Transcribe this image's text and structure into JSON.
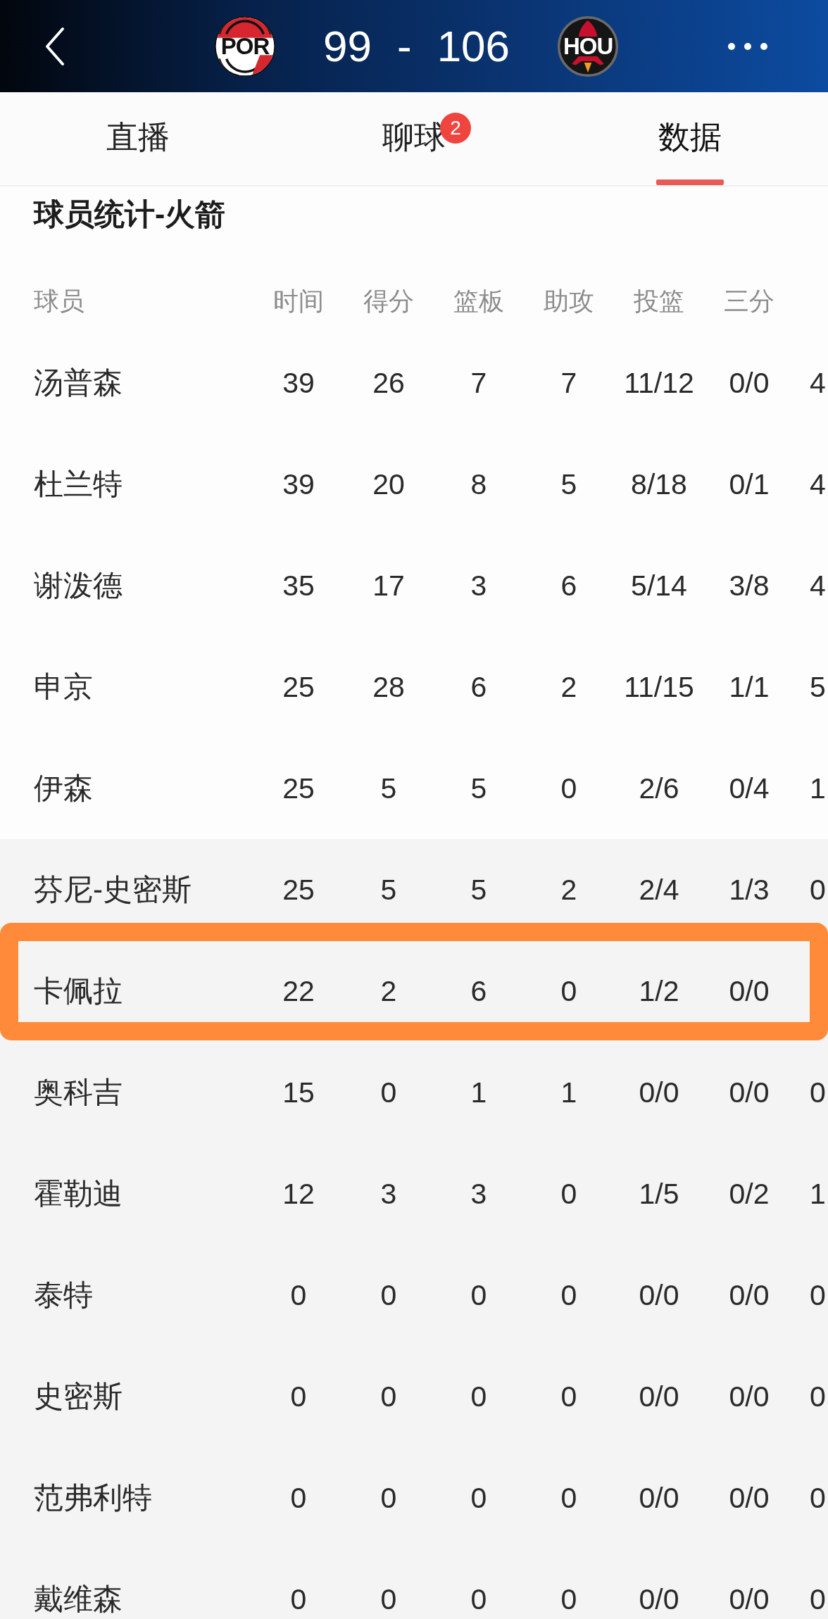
{
  "top_bar": {
    "home_team": {
      "abbr": "POR"
    },
    "score": {
      "home": "99",
      "separator": "-",
      "away": "106"
    },
    "away_team": {
      "abbr": "HOU"
    }
  },
  "tabs": [
    {
      "label": "直播",
      "selected": false
    },
    {
      "label": "聊球",
      "selected": false,
      "badge": "2"
    },
    {
      "label": "数据",
      "selected": true
    }
  ],
  "section_title": "球员统计-火箭",
  "table": {
    "columns": [
      "球员",
      "时间",
      "得分",
      "篮板",
      "助攻",
      "投篮",
      "三分"
    ],
    "rows": [
      {
        "kind": "starter",
        "cells": [
          "汤普森",
          "39",
          "26",
          "7",
          "7",
          "11/12",
          "0/0",
          "4"
        ],
        "highlighted": false
      },
      {
        "kind": "starter",
        "cells": [
          "杜兰特",
          "39",
          "20",
          "8",
          "5",
          "8/18",
          "0/1",
          "4"
        ],
        "highlighted": false
      },
      {
        "kind": "starter",
        "cells": [
          "谢泼德",
          "35",
          "17",
          "3",
          "6",
          "5/14",
          "3/8",
          "4"
        ],
        "highlighted": false
      },
      {
        "kind": "starter",
        "cells": [
          "申京",
          "25",
          "28",
          "6",
          "2",
          "11/15",
          "1/1",
          "5"
        ],
        "highlighted": false
      },
      {
        "kind": "starter",
        "cells": [
          "伊森",
          "25",
          "5",
          "5",
          "0",
          "2/6",
          "0/4",
          "1"
        ],
        "highlighted": false
      },
      {
        "kind": "bench",
        "cells": [
          "芬尼-史密斯",
          "25",
          "5",
          "5",
          "2",
          "2/4",
          "1/3",
          "0"
        ],
        "highlighted": false
      },
      {
        "kind": "bench",
        "cells": [
          "卡佩拉",
          "22",
          "2",
          "6",
          "0",
          "1/2",
          "0/0"
        ],
        "highlighted": true
      },
      {
        "kind": "bench",
        "cells": [
          "奥科吉",
          "15",
          "0",
          "1",
          "1",
          "0/0",
          "0/0",
          "0"
        ],
        "highlighted": false
      },
      {
        "kind": "bench",
        "cells": [
          "霍勒迪",
          "12",
          "3",
          "3",
          "0",
          "1/5",
          "0/2",
          "1"
        ],
        "highlighted": false
      },
      {
        "kind": "bench",
        "cells": [
          "泰特",
          "0",
          "0",
          "0",
          "0",
          "0/0",
          "0/0",
          "0"
        ],
        "highlighted": false
      },
      {
        "kind": "bench",
        "cells": [
          "史密斯",
          "0",
          "0",
          "0",
          "0",
          "0/0",
          "0/0",
          "0"
        ],
        "highlighted": false
      },
      {
        "kind": "bench",
        "cells": [
          "范弗利特",
          "0",
          "0",
          "0",
          "0",
          "0/0",
          "0/0",
          "0"
        ],
        "highlighted": false
      },
      {
        "kind": "bench",
        "cells": [
          "戴维森",
          "0",
          "0",
          "0",
          "0",
          "0/0",
          "0/0",
          "0"
        ],
        "highlighted": false
      }
    ]
  }
}
